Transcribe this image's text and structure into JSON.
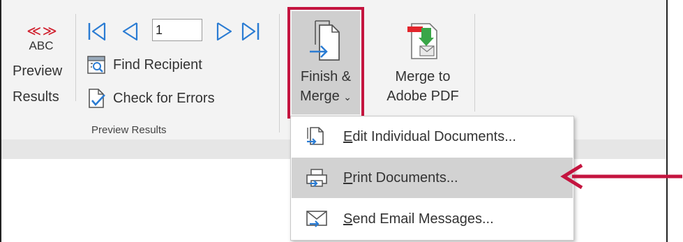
{
  "preview_group": {
    "preview_button": {
      "arrows": "≪ ≫",
      "abc": "ABC",
      "label_line1": "Preview",
      "label_line2": "Results"
    },
    "record_value": "1",
    "find_recipient": "Find Recipient",
    "check_errors": "Check for Errors",
    "group_label": "Preview Results"
  },
  "finish_group": {
    "finish_merge_line1": "Finish &",
    "finish_merge_line2": "Merge",
    "merge_pdf_line1": "Merge to",
    "merge_pdf_line2": "Adobe PDF"
  },
  "dropdown": {
    "items": [
      {
        "key": "E",
        "rest": "dit Individual Documents..."
      },
      {
        "key": "P",
        "rest": "rint Documents..."
      },
      {
        "key": "S",
        "rest": "end Email Messages..."
      }
    ],
    "highlighted_index": 1
  },
  "colors": {
    "highlight": "#c4143f",
    "accent_blue": "#2b7cd3",
    "menu_hover": "#d2d2d2"
  },
  "icons": [
    "first-record-icon",
    "previous-record-icon",
    "next-record-icon",
    "last-record-icon",
    "find-recipient-icon",
    "check-errors-icon",
    "finish-merge-icon",
    "adobe-pdf-icon",
    "edit-documents-icon",
    "print-documents-icon",
    "email-icon",
    "pointer-arrow"
  ]
}
